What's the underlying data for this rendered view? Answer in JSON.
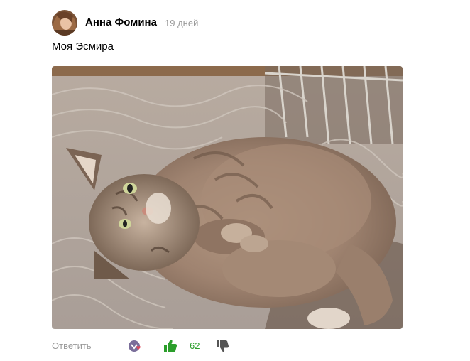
{
  "comment": {
    "author": "Анна Фомина",
    "time": "19 дней",
    "text": "Моя Эсмира",
    "photo_alt": "Моя Эсмира"
  },
  "footer": {
    "reply_label": "Ответить",
    "like_count": "62"
  },
  "icons": {
    "avatar": "avatar",
    "reactions": "reactions-icon",
    "like": "thumbs-up-icon",
    "dislike": "thumbs-down-icon"
  },
  "colors": {
    "author": "#000000",
    "meta": "#999999",
    "like_accent": "#2b9e2b",
    "dislike": "#555555"
  }
}
